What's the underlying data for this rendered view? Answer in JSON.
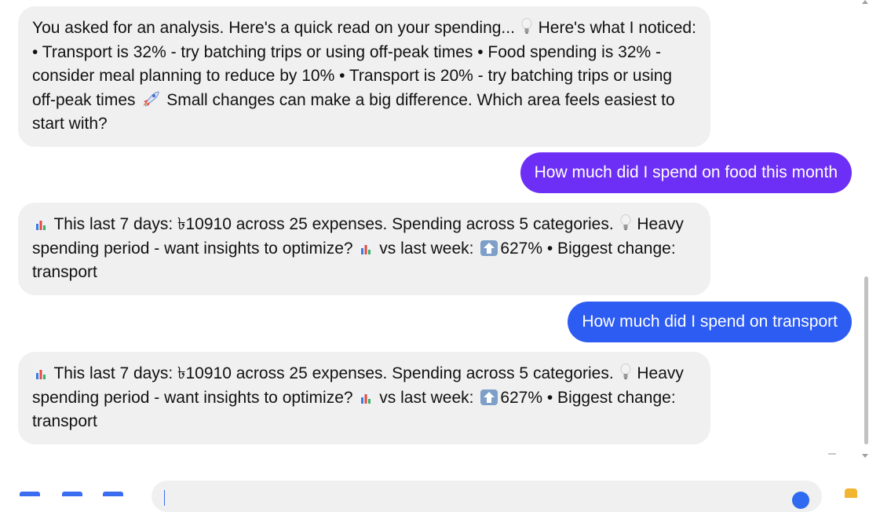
{
  "messages": [
    {
      "role": "assistant",
      "parts": {
        "p1": "You asked for an analysis. Here's a quick read on your spending...",
        "p2": "Here's what I noticed: • Transport is 32% - try batching trips or using off-peak times • Food spending is 32% - consider meal planning to reduce by 10% • Transport is 20% - try batching trips or using off-peak times",
        "p3": "Small changes can make a big difference. Which area feels easiest to start with?"
      }
    },
    {
      "role": "user",
      "text": "How much did I spend on food this month"
    },
    {
      "role": "assistant",
      "parts": {
        "p1": "This last 7 days: ৳10910 across 25 expenses. Spending across 5 categories.",
        "p2": "Heavy spending period - want insights to optimize?",
        "p3": "vs last week:",
        "p4": "627% • Biggest change: transport"
      }
    },
    {
      "role": "user",
      "text": "How much did I spend on transport"
    },
    {
      "role": "assistant",
      "parts": {
        "p1": "This last 7 days: ৳10910 across 25 expenses. Spending across 5 categories.",
        "p2": "Heavy spending period - want insights to optimize?",
        "p3": "vs last week:",
        "p4": "627% • Biggest change: transport"
      }
    }
  ],
  "icons": {
    "bulb": "lightbulb-icon",
    "rocket": "rocket-icon",
    "bars": "bar-chart-icon",
    "up": "up-arrow-icon"
  },
  "colors": {
    "user_bubble_1": "#6d2ff5",
    "user_bubble_2": "#2d5cf2",
    "bot_bubble": "#f0f0f0"
  }
}
